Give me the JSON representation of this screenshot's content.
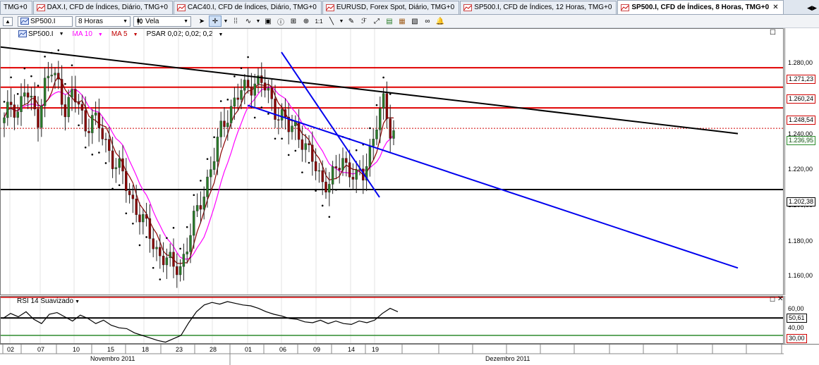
{
  "tabs": [
    {
      "label": "TMG+0",
      "active": false
    },
    {
      "label": "DAX.I, CFD de Índices, Diário, TMG+0",
      "active": false
    },
    {
      "label": "CAC40.I, CFD de Índices, Diário, TMG+0",
      "active": false
    },
    {
      "label": "EURUSD, Forex Spot, Diário, TMG+0",
      "active": false
    },
    {
      "label": "SP500.I, CFD de Índices, 12 Horas, TMG+0",
      "active": false
    },
    {
      "label": "SP500.I, CFD de Índices, 8 Horas, TMG+0",
      "active": true
    }
  ],
  "toolbar": {
    "symbol": "SP500.I",
    "timeframe": "8 Horas",
    "chart_type": "Vela",
    "zoom_label": "1:1"
  },
  "indicators": {
    "symbol": "SP500.I",
    "ma10": "MA 10",
    "ma5": "MA 5",
    "psar": "PSAR 0,02; 0,02; 0,2",
    "rsi_title": "RSI 14 Suavizado"
  },
  "price_axis": {
    "ticks": [
      "1.280,00",
      "1.260,00",
      "1.240,00",
      "1.220,00",
      "1.200,00",
      "1.180,00",
      "1.160,00"
    ],
    "levels": [
      {
        "label": "1.271,23",
        "color": "red"
      },
      {
        "label": "1.260,24",
        "color": "red"
      },
      {
        "label": "1.248,54",
        "color": "red"
      },
      {
        "label": "1.236,95",
        "color": "green"
      },
      {
        "label": "1.202,38",
        "color": "black"
      }
    ]
  },
  "rsi_axis": {
    "ticks": [
      "60,00",
      "40,00"
    ],
    "levels": [
      {
        "label": "50,61",
        "color": "black"
      },
      {
        "label": "30,00",
        "color": "red"
      }
    ]
  },
  "time_axis": {
    "days": [
      "02",
      "07",
      "10",
      "15",
      "18",
      "23",
      "28",
      "01",
      "06",
      "09",
      "14",
      "19"
    ],
    "months": [
      "Novembro 2011",
      "Dezembro 2011"
    ]
  },
  "chart_data": [
    {
      "type": "candlestick",
      "symbol": "SP500.I",
      "timeframe": "8 Horas",
      "ylim": [
        1150,
        1292
      ],
      "x_ticks": [
        "02",
        "07",
        "10",
        "15",
        "18",
        "23",
        "28",
        "01",
        "06",
        "09",
        "14",
        "19"
      ],
      "y_ticks": [
        1160,
        1180,
        1200,
        1220,
        1240,
        1260,
        1280
      ],
      "anchor_closes": [
        1240,
        1252,
        1247,
        1258,
        1250,
        1244,
        1262,
        1268,
        1262,
        1249,
        1255,
        1250,
        1238,
        1244,
        1236,
        1229,
        1220,
        1214,
        1204,
        1196,
        1188,
        1180,
        1172,
        1166,
        1162,
        1158,
        1160,
        1170,
        1184,
        1196,
        1208,
        1220,
        1236,
        1246,
        1252,
        1257,
        1261,
        1264,
        1262,
        1256,
        1248,
        1244,
        1236,
        1238,
        1231,
        1222,
        1214,
        1208,
        1206,
        1212,
        1220,
        1214,
        1208,
        1210,
        1226,
        1240,
        1250,
        1236
      ],
      "horizontal_levels": [
        1271.23,
        1260.24,
        1248.54,
        1236.95,
        1202.38
      ],
      "last_price": 1236.95,
      "series": [
        {
          "name": "MA 10",
          "color": "#ff00ff"
        },
        {
          "name": "MA 5",
          "color": "#8b0000"
        },
        {
          "name": "PSAR 0,02; 0,02; 0,2",
          "color": "#000000"
        }
      ],
      "trendlines": [
        {
          "from": [
            "start",
            1283
          ],
          "to": [
            "after 19",
            1234
          ],
          "color": "#000000"
        },
        {
          "from": [
            "06",
            1280
          ],
          "to": [
            "19",
            1198
          ],
          "color": "#0000ee"
        },
        {
          "from": [
            "01",
            1250
          ],
          "to": [
            "after 19",
            1158
          ],
          "color": "#0000ee"
        }
      ]
    },
    {
      "type": "line",
      "name": "RSI 14 Suavizado",
      "ylim": [
        20,
        75
      ],
      "y_ticks": [
        40,
        60
      ],
      "levels": [
        50.61,
        30.0
      ],
      "values": [
        50,
        56,
        52,
        58,
        49,
        44,
        55,
        57,
        52,
        47,
        54,
        50,
        44,
        48,
        42,
        39,
        38,
        33,
        30,
        27,
        24,
        22,
        26,
        30,
        45,
        58,
        66,
        69,
        67,
        70,
        68,
        66,
        65,
        62,
        58,
        55,
        53,
        50,
        49,
        46,
        45,
        48,
        44,
        47,
        44,
        43,
        47,
        45,
        48,
        56,
        62,
        58
      ]
    }
  ],
  "colors": {
    "bull": "#2a7d2a",
    "bear": "#8b0000",
    "ma10": "#ff00ff",
    "ma5": "#8b0000",
    "level_red": "#e00000",
    "trend_blue": "#0000ee",
    "rsi_green": "#2e8b2e"
  }
}
